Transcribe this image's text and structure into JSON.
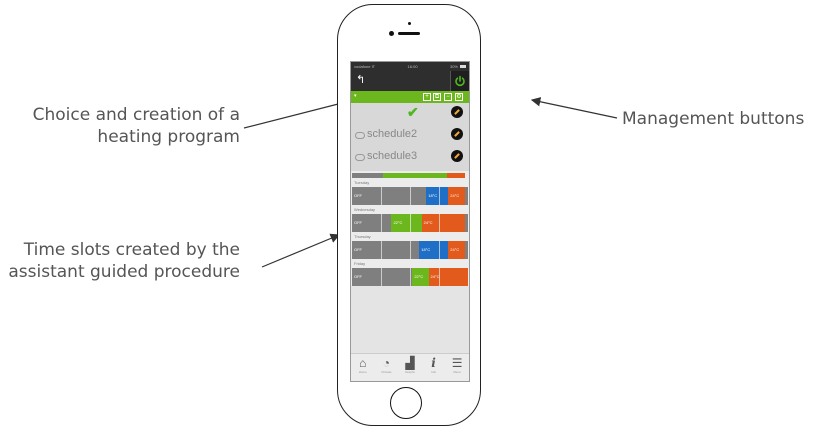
{
  "callouts": {
    "program": "Choice and creation of a heating program",
    "slots": "Time slots created by the assistant guided procedure",
    "management": "Management buttons"
  },
  "status_bar": {
    "left": "vodafone IT",
    "center": "16:00",
    "right": "30%"
  },
  "header": {
    "back_icon": "back-arrow-icon",
    "power_icon": "power-icon",
    "power_color": "#4fb81e"
  },
  "program_bar": {
    "color": "#6cb71e",
    "buttons": [
      {
        "name": "add",
        "glyph": "+"
      },
      {
        "name": "copy",
        "glyph": "⧉"
      },
      {
        "name": "remove",
        "glyph": "−"
      },
      {
        "name": "settings",
        "glyph": "⚙"
      }
    ]
  },
  "programs": [
    {
      "name": "",
      "selected": true
    },
    {
      "name": "schedule2",
      "selected": false
    },
    {
      "name": "schedule3",
      "selected": false
    }
  ],
  "days": [
    {
      "name": "Tuesday",
      "slots": [
        {
          "label": "OFF",
          "start": 0,
          "end": 0.64,
          "color": "#7f7f7f"
        },
        {
          "label": "18°C",
          "start": 0.64,
          "end": 0.83,
          "color": "#1f6fc6"
        },
        {
          "label": "24°C",
          "start": 0.83,
          "end": 0.97,
          "color": "#e25a1c"
        },
        {
          "label": "",
          "start": 0.97,
          "end": 1,
          "color": "#7f7f7f"
        }
      ]
    },
    {
      "name": "Wednesday",
      "slots": [
        {
          "label": "OFF",
          "start": 0,
          "end": 0.34,
          "color": "#7f7f7f"
        },
        {
          "label": "22°C",
          "start": 0.34,
          "end": 0.6,
          "color": "#6cb71e"
        },
        {
          "label": "24°C",
          "start": 0.6,
          "end": 0.97,
          "color": "#e25a1c"
        },
        {
          "label": "",
          "start": 0.97,
          "end": 1,
          "color": "#7f7f7f"
        }
      ]
    },
    {
      "name": "Thursday",
      "slots": [
        {
          "label": "OFF",
          "start": 0,
          "end": 0.58,
          "color": "#7f7f7f"
        },
        {
          "label": "18°C",
          "start": 0.58,
          "end": 0.83,
          "color": "#1f6fc6"
        },
        {
          "label": "24°C",
          "start": 0.83,
          "end": 0.97,
          "color": "#e25a1c"
        },
        {
          "label": "",
          "start": 0.97,
          "end": 1,
          "color": "#7f7f7f"
        }
      ]
    },
    {
      "name": "Friday",
      "slots": [
        {
          "label": "OFF",
          "start": 0,
          "end": 0.52,
          "color": "#7f7f7f"
        },
        {
          "label": "22°C",
          "start": 0.52,
          "end": 0.66,
          "color": "#6cb71e"
        },
        {
          "label": "24°C",
          "start": 0.66,
          "end": 1,
          "color": "#e25a1c"
        }
      ]
    }
  ],
  "nav": [
    {
      "label": "Home",
      "icon": "home-icon",
      "glyph": "⌂"
    },
    {
      "label": "Climate",
      "icon": "thermostat-icon",
      "glyph": "◔"
    },
    {
      "label": "Graphs",
      "icon": "chart-icon",
      "glyph": "▟"
    },
    {
      "label": "Info",
      "icon": "info-icon",
      "glyph": "i"
    },
    {
      "label": "Menu",
      "icon": "menu-icon",
      "glyph": "☰"
    }
  ]
}
